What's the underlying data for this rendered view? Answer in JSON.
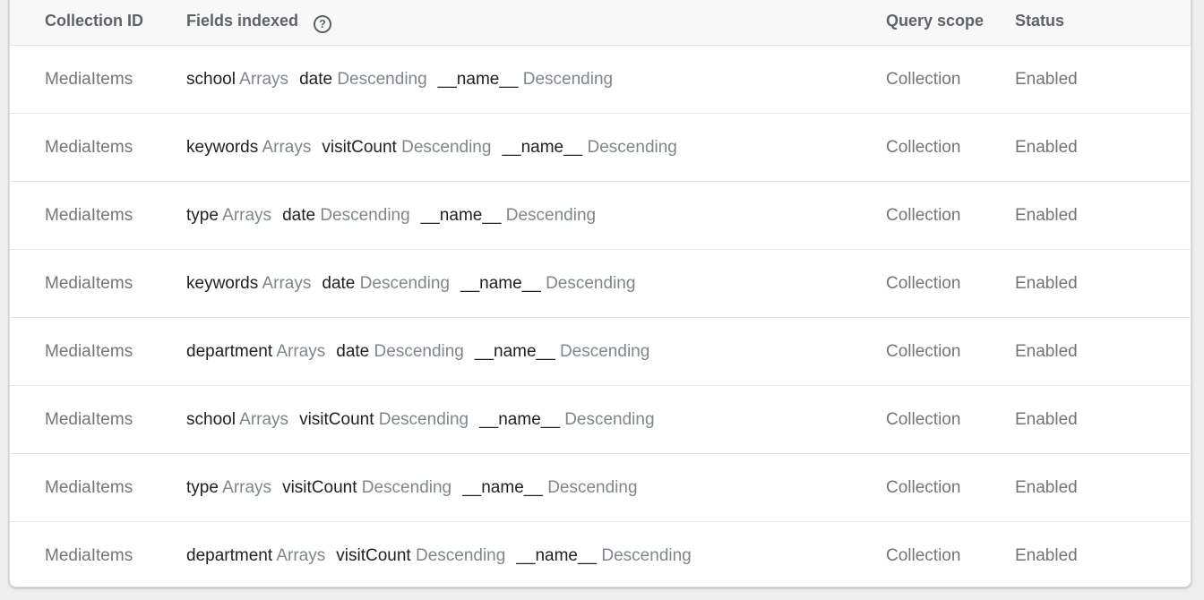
{
  "table": {
    "headers": {
      "collection_id": "Collection ID",
      "fields_indexed": "Fields indexed",
      "help_icon": "?",
      "query_scope": "Query scope",
      "status": "Status"
    },
    "rows": [
      {
        "collection": "MediaItems",
        "fields": [
          {
            "name": "school",
            "mode": "Arrays"
          },
          {
            "name": "date",
            "mode": "Descending"
          },
          {
            "name": "__name__",
            "mode": "Descending"
          }
        ],
        "scope": "Collection",
        "status": "Enabled"
      },
      {
        "collection": "MediaItems",
        "fields": [
          {
            "name": "keywords",
            "mode": "Arrays"
          },
          {
            "name": "visitCount",
            "mode": "Descending"
          },
          {
            "name": "__name__",
            "mode": "Descending"
          }
        ],
        "scope": "Collection",
        "status": "Enabled"
      },
      {
        "collection": "MediaItems",
        "fields": [
          {
            "name": "type",
            "mode": "Arrays"
          },
          {
            "name": "date",
            "mode": "Descending"
          },
          {
            "name": "__name__",
            "mode": "Descending"
          }
        ],
        "scope": "Collection",
        "status": "Enabled"
      },
      {
        "collection": "MediaItems",
        "fields": [
          {
            "name": "keywords",
            "mode": "Arrays"
          },
          {
            "name": "date",
            "mode": "Descending"
          },
          {
            "name": "__name__",
            "mode": "Descending"
          }
        ],
        "scope": "Collection",
        "status": "Enabled"
      },
      {
        "collection": "MediaItems",
        "fields": [
          {
            "name": "department",
            "mode": "Arrays"
          },
          {
            "name": "date",
            "mode": "Descending"
          },
          {
            "name": "__name__",
            "mode": "Descending"
          }
        ],
        "scope": "Collection",
        "status": "Enabled"
      },
      {
        "collection": "MediaItems",
        "fields": [
          {
            "name": "school",
            "mode": "Arrays"
          },
          {
            "name": "visitCount",
            "mode": "Descending"
          },
          {
            "name": "__name__",
            "mode": "Descending"
          }
        ],
        "scope": "Collection",
        "status": "Enabled"
      },
      {
        "collection": "MediaItems",
        "fields": [
          {
            "name": "type",
            "mode": "Arrays"
          },
          {
            "name": "visitCount",
            "mode": "Descending"
          },
          {
            "name": "__name__",
            "mode": "Descending"
          }
        ],
        "scope": "Collection",
        "status": "Enabled"
      },
      {
        "collection": "MediaItems",
        "fields": [
          {
            "name": "department",
            "mode": "Arrays"
          },
          {
            "name": "visitCount",
            "mode": "Descending"
          },
          {
            "name": "__name__",
            "mode": "Descending"
          }
        ],
        "scope": "Collection",
        "status": "Enabled"
      }
    ]
  }
}
